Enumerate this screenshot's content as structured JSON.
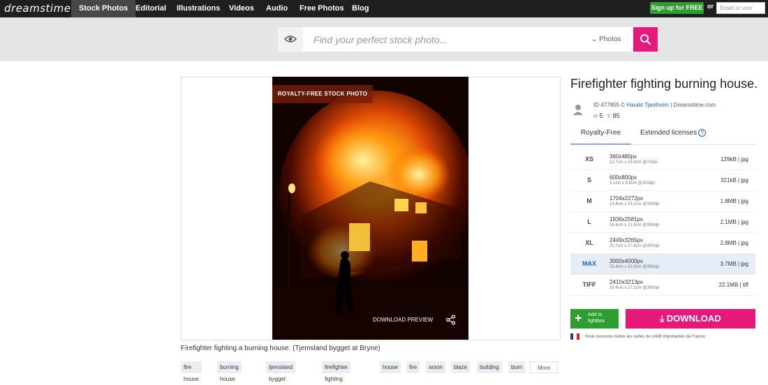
{
  "topnav": {
    "logo": "dreamstime",
    "items": [
      {
        "label": "Stock Photos",
        "active": true
      },
      {
        "label": "Editorial"
      },
      {
        "label": "Illustrations"
      },
      {
        "label": "Videos"
      },
      {
        "label": "Audio"
      },
      {
        "label": "Free Photos"
      },
      {
        "label": "Blog"
      }
    ],
    "signup_label": "Sign up for FREE",
    "or_text": "or",
    "login_placeholder": "Email or user"
  },
  "search": {
    "placeholder": "Find your perfect stock photo...",
    "type_label": "Photos"
  },
  "image": {
    "badge": "ROYALTY-FREE STOCK PHOTO",
    "download_preview": "DOWNLOAD PREVIEW",
    "caption": "Firefighter fighting a burning house. (Tjemsland bygget at Bryne)"
  },
  "tags": [
    "fire house",
    "burning house",
    "tjemsland bygget",
    "firefighter fighting",
    "house",
    "fire",
    "arson",
    "blaze",
    "building",
    "burn"
  ],
  "more_label": "More",
  "details": {
    "title": "Firefighter fighting burning house.",
    "id_text": "ID 477855 © ",
    "author": "Harald Tjøstheim",
    "site_text": " | Dreamstime.com",
    "views": "5",
    "downloads": "85",
    "tab_royalty": "Royalty-Free",
    "tab_extended": "Extended licenses",
    "help": "?"
  },
  "sizes": [
    {
      "code": "XS",
      "px": "360x480px",
      "cm": "12.7cm x 16.9cm @72dpi",
      "file": "129kB | jpg"
    },
    {
      "code": "S",
      "px": "600x800px",
      "cm": "5.1cm x 6.8cm @300dpi",
      "file": "321kB | jpg"
    },
    {
      "code": "M",
      "px": "1704x2272px",
      "cm": "14.4cm x 19.2cm @300dpi",
      "file": "1.8MB | jpg"
    },
    {
      "code": "L",
      "px": "1936x2581px",
      "cm": "16.4cm x 21.9cm @300dpi",
      "file": "2.1MB | jpg"
    },
    {
      "code": "XL",
      "px": "2449x3265px",
      "cm": "20.7cm x 27.6cm @300dpi",
      "file": "2.8MB | jpg"
    },
    {
      "code": "MAX",
      "px": "3000x4000px",
      "cm": "25.4cm x 33.9cm @300dpi",
      "file": "3.7MB | jpg",
      "selected": true
    },
    {
      "code": "TIFF",
      "px": "2410x3213px",
      "cm": "20.4cm x 27.2cm @300dpi",
      "file": "22.1MB | tiff"
    }
  ],
  "actions": {
    "add_lightbox_1": "Add to",
    "add_lightbox_2": "lightbox",
    "download": "DOWNLOAD",
    "credit_note": "Nous recevons toutes les cartes de crédit importantes de France."
  },
  "colors": {
    "accent_pink": "#e6197a",
    "accent_green": "#2e9e30",
    "link_blue": "#1f64b8"
  }
}
